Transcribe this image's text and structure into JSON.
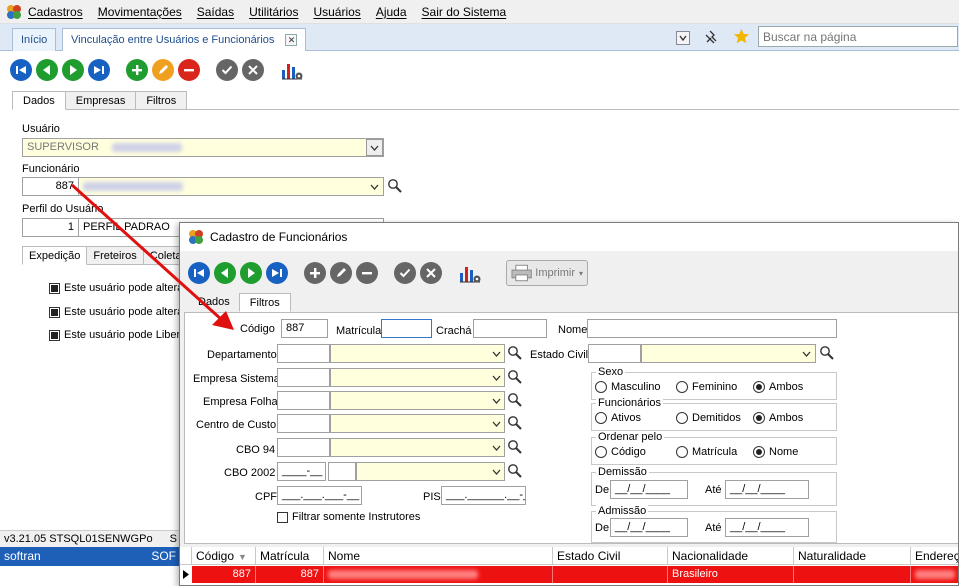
{
  "menu": {
    "items": [
      "Cadastros",
      "Movimentações",
      "Saídas",
      "Utilitários",
      "Usuários",
      "Ajuda",
      "Sair do Sistema"
    ]
  },
  "tabs": {
    "inicio": "Início",
    "vinculacao": "Vinculação entre Usuários e Funcionários",
    "search_placeholder": "Buscar na página"
  },
  "main": {
    "subtabs": [
      "Dados",
      "Empresas",
      "Filtros"
    ],
    "usuario_label": "Usuário",
    "usuario_value": "SUPERVISOR",
    "funcionario_label": "Funcionário",
    "funcionario_code": "887",
    "perfil_label": "Perfil do Usuário",
    "perfil_code": "1",
    "perfil_value": "PERFIL PADRAO",
    "inner_tabs": [
      "Expedição",
      "Freteiros",
      "Coletas"
    ],
    "checkboxes": [
      "Este usuário pode altera",
      "Este usuário pode altera",
      "Este usuário pode Liber"
    ]
  },
  "status": {
    "version": "v3.21.05  STSQL01SENWGPo",
    "extra": "S",
    "user": "softran",
    "user_extra": "SOF"
  },
  "modal": {
    "title": "Cadastro de Funcionários",
    "print_label": "Imprimir",
    "tabs": [
      "Dados",
      "Filtros"
    ],
    "labels": {
      "codigo": "Código",
      "matricula": "Matrícula",
      "cracha": "Crachá",
      "nome": "Nome",
      "departamento": "Departamento",
      "estado_civil": "Estado Civil",
      "empresa_sistema": "Empresa Sistema",
      "empresa_folha": "Empresa Folha",
      "centro_custo": "Centro de Custo",
      "cbo94": "CBO 94",
      "cbo2002": "CBO 2002",
      "cpf": "CPF",
      "pis": "PIS",
      "filtrar_instrutores": "Filtrar somente Instrutores"
    },
    "values": {
      "codigo": "887",
      "cbo2002_mask": "____-__",
      "cpf_mask": "___.___.___-__",
      "pis_mask": "___.______.__-_"
    },
    "sexo": {
      "legend": "Sexo",
      "options": [
        "Masculino",
        "Feminino",
        "Ambos"
      ],
      "selected": "Ambos"
    },
    "funcionarios": {
      "legend": "Funcionários",
      "options": [
        "Ativos",
        "Demitidos",
        "Ambos"
      ],
      "selected": "Ambos"
    },
    "ordenar": {
      "legend": "Ordenar pelo",
      "options": [
        "Código",
        "Matrícula",
        "Nome"
      ],
      "selected": "Nome"
    },
    "demissao": {
      "legend": "Demissão",
      "de": "De",
      "ate": "Até",
      "mask": "__/__/____"
    },
    "admissao": {
      "legend": "Admissão",
      "de": "De",
      "ate": "Até",
      "mask": "__/__/____"
    },
    "grid": {
      "columns": [
        "Código",
        "Matrícula",
        "Nome",
        "Estado Civil",
        "Nacionalidade",
        "Naturalidade",
        "Endereço"
      ],
      "row": {
        "codigo": "887",
        "matricula": "887",
        "nacionalidade": "Brasileiro"
      }
    }
  },
  "colors": {
    "accent_blue": "#1761c2",
    "accent_green": "#1f9d2e",
    "highlight_red": "#ee1111",
    "arrow_red": "#e01010",
    "field_yellow": "#ffffde"
  }
}
